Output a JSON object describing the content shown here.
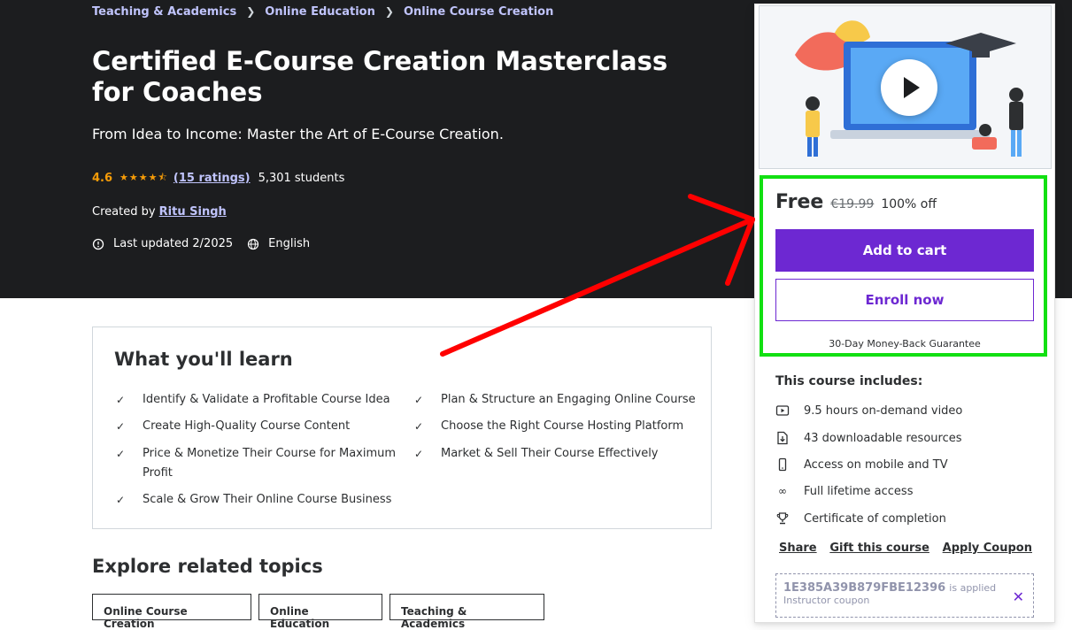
{
  "breadcrumb": [
    "Teaching & Academics",
    "Online Education",
    "Online Course Creation"
  ],
  "course": {
    "title": "Certified E-Course Creation Masterclass for Coaches",
    "subtitle": "From Idea to Income: Master the Art of E-Course Creation.",
    "rating": "4.6",
    "ratings_count": "(15 ratings)",
    "students": "5,301 students",
    "created_by_label": "Created by",
    "instructor": "Ritu Singh",
    "last_updated": "Last updated 2/2025",
    "language": "English"
  },
  "learn": {
    "heading": "What you'll learn",
    "items": [
      "Identify & Validate a Profitable Course Idea",
      "Plan & Structure an Engaging Online Course",
      "Create High-Quality Course Content",
      "Choose the Right Course Hosting Platform",
      "Price & Monetize Their Course for Maximum Profit",
      "Market & Sell Their Course Effectively",
      "Scale & Grow Their Online Course Business"
    ]
  },
  "explore": {
    "heading": "Explore related topics",
    "tags": [
      "Online Course Creation",
      "Online Education",
      "Teaching & Academics"
    ]
  },
  "sidebar": {
    "price": "Free",
    "original_price": "€19.99",
    "discount": "100% off",
    "add_to_cart": "Add to cart",
    "enroll_now": "Enroll now",
    "guarantee": "30-Day Money-Back Guarantee",
    "includes_title": "This course includes:",
    "includes": [
      {
        "icon": "video-icon",
        "text": "9.5 hours on-demand video"
      },
      {
        "icon": "file-download-icon",
        "text": "43 downloadable resources"
      },
      {
        "icon": "mobile-icon",
        "text": "Access on mobile and TV"
      },
      {
        "icon": "infinity-icon",
        "text": "Full lifetime access"
      },
      {
        "icon": "trophy-icon",
        "text": "Certificate of completion"
      }
    ],
    "share": "Share",
    "gift": "Gift this course",
    "apply_coupon": "Apply Coupon",
    "coupon_code": "1E385A39B879FBE12396",
    "coupon_applied": "is applied",
    "coupon_note": "Instructor coupon"
  },
  "colors": {
    "hero_bg": "#1c1d1f",
    "accent": "#6d28d2",
    "star": "#f69c08",
    "link_light": "#c0c4fc",
    "highlight_box": "#12e012",
    "annotation_arrow": "#ff0000"
  }
}
